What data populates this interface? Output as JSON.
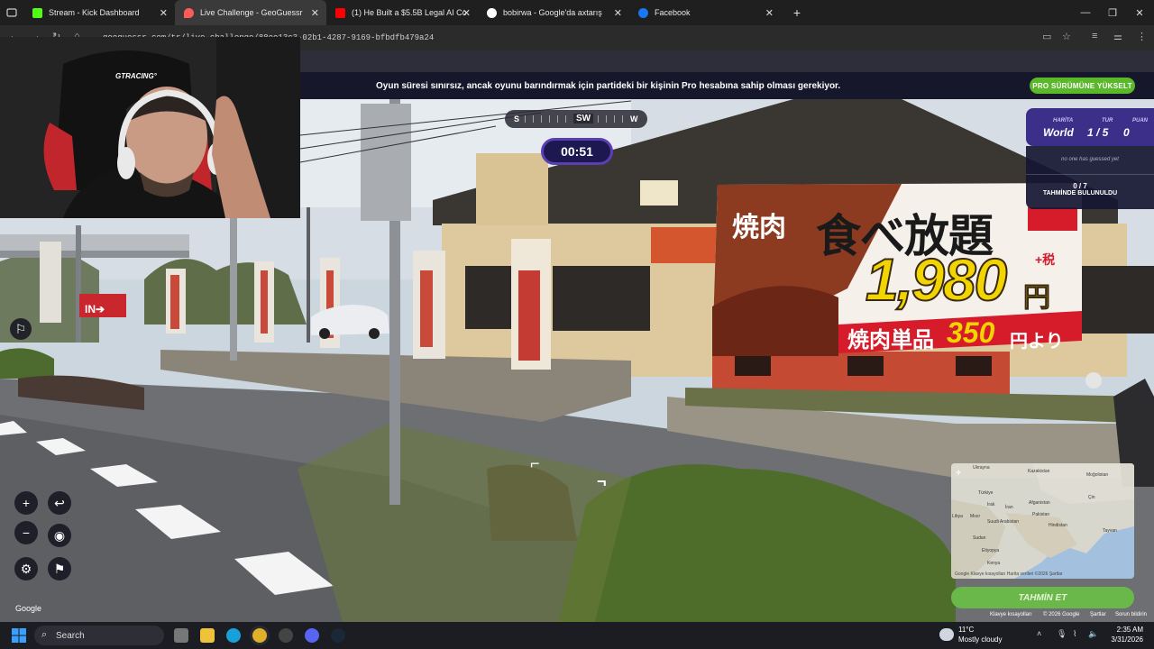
{
  "browser": {
    "tabs": [
      {
        "title": "Stream - Kick Dashboard",
        "favicon": "kick-icon",
        "color": "#53fc18"
      },
      {
        "title": "Live Challenge - GeoGuessr",
        "favicon": "geoguessr-pin-icon",
        "color": "#ff5a5a"
      },
      {
        "title": "(1) He Built a $5.5B Legal AI Co",
        "favicon": "youtube-icon",
        "color": "#ff0000"
      },
      {
        "title": "bobirwa - Google'da axtarış",
        "favicon": "google-icon",
        "color": "#ffffff"
      },
      {
        "title": "Facebook",
        "favicon": "facebook-icon",
        "color": "#1877f2"
      }
    ],
    "url": "geoguessr.com/tr/live-challenge/88ee13c3-02b1-4287-9169-bfbdfb479a24"
  },
  "banner": {
    "message": "Oyun süresi sınırsız, ancak oyunu barındırmak için partideki bir kişinin Pro hesabına sahip olması gerekiyor.",
    "upgrade_button": "PRO SÜRÜMÜNE YÜKSELT"
  },
  "compass": {
    "left": "S",
    "heading": "SW",
    "right": "W"
  },
  "timer": "00:51",
  "game": {
    "map_label": "HARİTA",
    "map_value": "World",
    "round_label": "TUR",
    "round_value": "1 / 5",
    "score_label": "PUAN",
    "score_value": "0",
    "no_guess_text": "no one has guessed yet",
    "guess_count": "0 / 7",
    "guess_count_label": "TAHMİNDE BULUNULDU"
  },
  "scene_text": {
    "sign_line1_a": "焼肉",
    "sign_line1_b": "食べ放題",
    "sign_price": "1,980",
    "sign_yen": "円",
    "sign_tax": "+税",
    "sign_line3_a": "焼肉単品",
    "sign_line3_b": "350",
    "sign_line3_c": "円より",
    "entrance": "IN➔"
  },
  "map": {
    "labels": [
      "Ukrayna",
      "Kazakistan",
      "Moğolistan",
      "Türkiye",
      "Afganistan",
      "Çin",
      "Irak",
      "İran",
      "Libya",
      "Mısır",
      "Pakistan",
      "Suudi Arabistan",
      "Hindistan",
      "Sudan",
      "Tayvan",
      "Etiyopya",
      "Kenya"
    ],
    "footer": "Google   Klavye kısayolları   Harita verileri ©2026   Şartlar"
  },
  "guess_button": "TAHMİN ET",
  "attribution": {
    "keyboard": "Klavye kısayolları",
    "data": "© 2026 Google",
    "terms": "Şartlar",
    "report": "Sorun bildirin"
  },
  "google_logo": "Google",
  "taskbar": {
    "search_placeholder": "Search",
    "temperature": "11°C",
    "weather": "Mostly cloudy",
    "time": "2:35 AM",
    "date": "3/31/2026"
  }
}
